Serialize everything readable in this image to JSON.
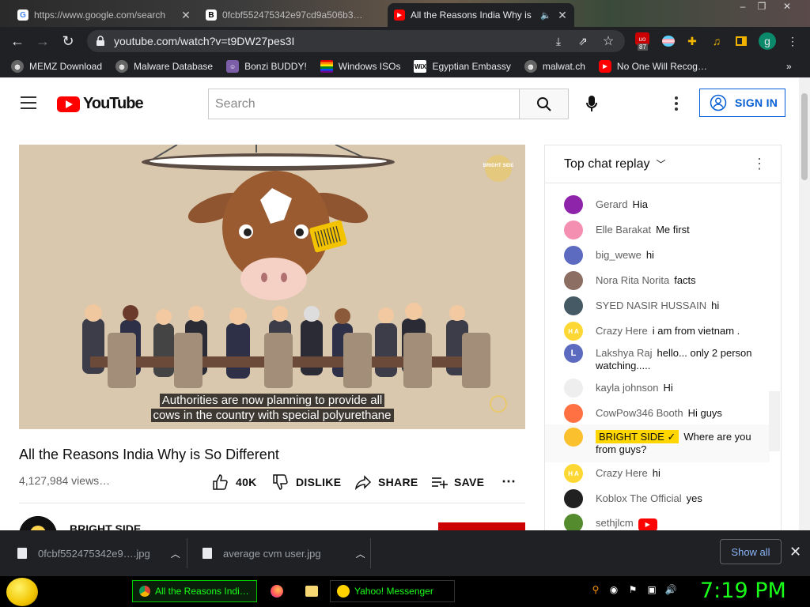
{
  "browser": {
    "tabs": [
      {
        "title": "https://www.google.com/search",
        "favicon": "google-icon",
        "active": false
      },
      {
        "title": "0fcbf552475342e97cd9a506b3…",
        "favicon": "b-icon",
        "active": false
      },
      {
        "title": "All the Reasons India Why is",
        "favicon": "youtube-icon",
        "active": true
      }
    ],
    "url": "youtube.com/watch?v=t9DW27pes3I",
    "extension_badge": "87",
    "profile_initial": "g",
    "bookmarks": [
      {
        "label": "MEMZ Download",
        "icon": "globe-icon"
      },
      {
        "label": "Malware Database",
        "icon": "globe-icon"
      },
      {
        "label": "Bonzi BUDDY!",
        "icon": "bonzi-icon"
      },
      {
        "label": "Windows ISOs",
        "icon": "rainbow-icon"
      },
      {
        "label": "Egyptian Embassy",
        "icon": "wix-icon"
      },
      {
        "label": "malwat.ch",
        "icon": "globe-icon"
      },
      {
        "label": "No One Will Recog…",
        "icon": "youtube-icon"
      }
    ],
    "bookmarks_overflow": "»"
  },
  "youtube": {
    "logo_text": "YouTube",
    "search_placeholder": "Search",
    "sign_in": "SIGN IN",
    "video": {
      "caption_line1": "Authorities are now planning to provide all",
      "caption_line2": "cows in the country with special polyurethane",
      "watermark": "BRIGHT SIDE"
    },
    "title": "All the Reasons India Why is So Different",
    "views": "4,127,984 views…",
    "actions": {
      "like_count": "40K",
      "dislike": "DISLIKE",
      "share": "SHARE",
      "save": "SAVE"
    },
    "channel_name": "BRIGHT SIDE"
  },
  "chat": {
    "header": "Top chat replay",
    "messages": [
      {
        "author": "Gerard",
        "text": "Hia",
        "avatar_color": "#8e24aa",
        "initial": ""
      },
      {
        "author": "Elle Barakat",
        "text": "Me first",
        "avatar_color": "#f48fb1",
        "initial": ""
      },
      {
        "author": "big_wewe",
        "text": "hi",
        "avatar_color": "#5c6bc0",
        "initial": ""
      },
      {
        "author": "Nora Rita Norita",
        "text": "facts",
        "avatar_color": "#8d6e63",
        "initial": ""
      },
      {
        "author": "SYED NASIR HUSSAIN",
        "text": "hi",
        "avatar_color": "#455a64",
        "initial": ""
      },
      {
        "author": "Crazy Here",
        "text": "i am from vietnam .",
        "avatar_color": "#fdd835",
        "initial": "H A"
      },
      {
        "author": "Lakshya Raj",
        "text": "hello... only 2 person watching.....",
        "avatar_color": "#5c6bc0",
        "initial": "L"
      },
      {
        "author": "kayla johnson",
        "text": "Hi",
        "avatar_color": "#eeeeee",
        "initial": ""
      },
      {
        "author": "CowPow346 Booth",
        "text": "Hi guys",
        "avatar_color": "#ff7043",
        "initial": ""
      },
      {
        "author": "BRIGHT SIDE",
        "text": "Where are you from guys?",
        "avatar_color": "#fbc02d",
        "initial": "",
        "owner": true
      },
      {
        "author": "Crazy Here",
        "text": "hi",
        "avatar_color": "#fdd835",
        "initial": "H A"
      },
      {
        "author": "Koblox The Official",
        "text": "yes",
        "avatar_color": "#212121",
        "initial": ""
      },
      {
        "author": "sethjlcm",
        "text": "",
        "avatar_color": "#558b2f",
        "initial": "",
        "youtube_emoji": true
      }
    ]
  },
  "downloads": {
    "items": [
      {
        "name": "0fcbf552475342e9….jpg"
      },
      {
        "name": "average cvm user.jpg"
      }
    ],
    "show_all": "Show all"
  },
  "taskbar": {
    "tasks": [
      {
        "label": "All the Reasons Indi…",
        "icon": "chrome-icon",
        "active": true
      },
      {
        "label": "",
        "icon": "firefox-icon",
        "active": false
      },
      {
        "label": "",
        "icon": "folder-icon",
        "active": false
      },
      {
        "label": "Yahoo! Messenger",
        "icon": "yahoo-messenger-icon",
        "active": false
      }
    ],
    "clock": "7:19 PM"
  }
}
